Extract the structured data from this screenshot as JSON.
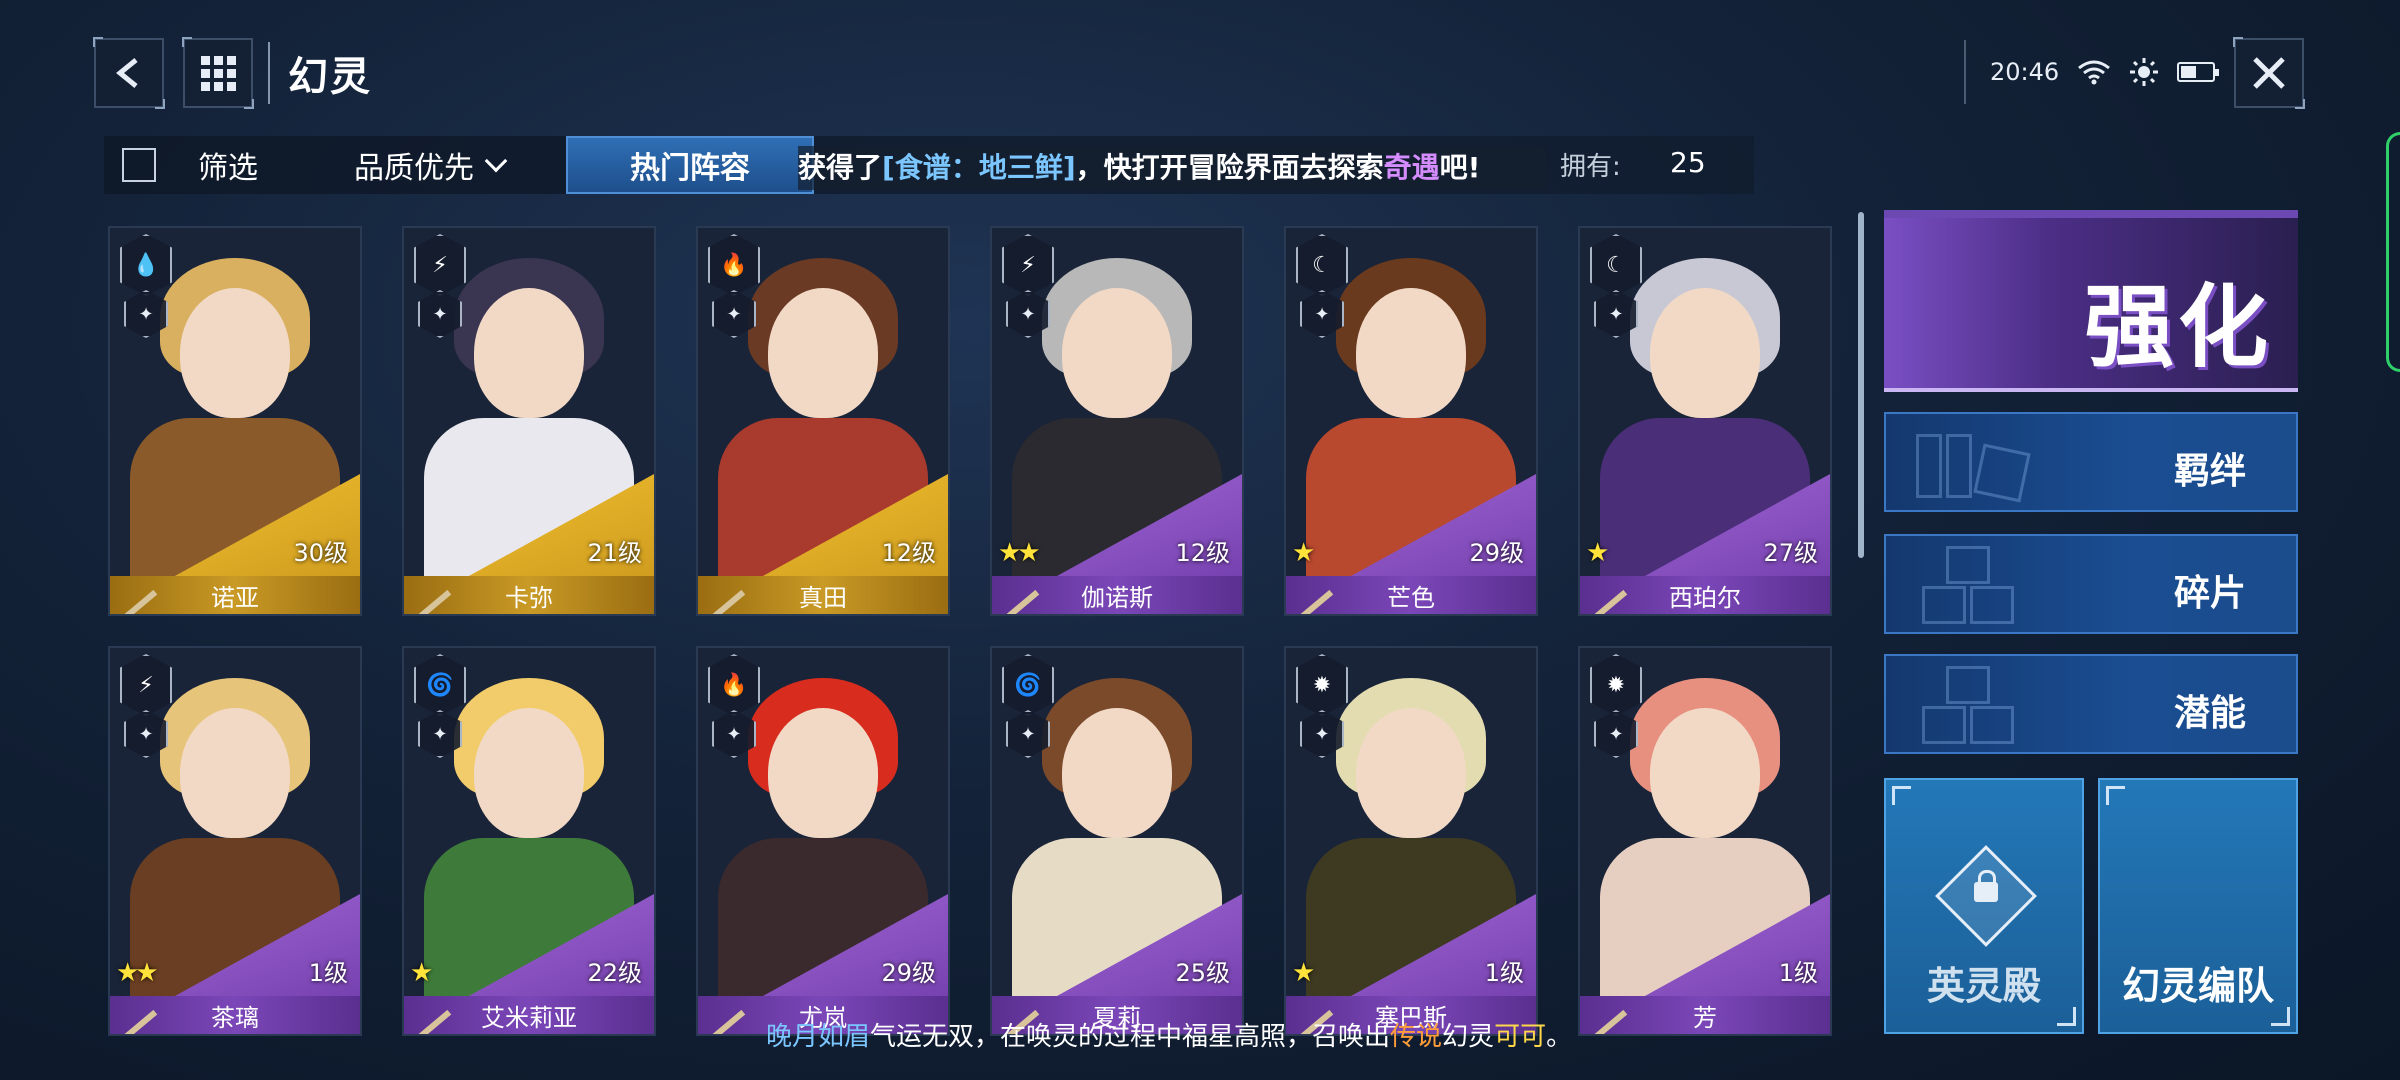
{
  "header": {
    "title": "幻灵",
    "time": "20:46"
  },
  "filter": {
    "label": "筛选",
    "sort_label": "品质优先",
    "hot_button": "热门阵容",
    "own_label": "拥有:",
    "own_count": "25"
  },
  "marquee": {
    "prefix": "获得了",
    "item": "[食谱：地三鲜]",
    "middle": "，快打开冒险界面去探索",
    "highlight": "奇遇",
    "suffix": "吧!"
  },
  "cards": [
    {
      "name": "诺亚",
      "level": "30级",
      "stars": "",
      "rarity": "gold",
      "element": "water",
      "element_icon": "💧",
      "color": "#8a5a2b",
      "hair": "#d8b060"
    },
    {
      "name": "卡弥",
      "level": "21级",
      "stars": "",
      "rarity": "gold",
      "element": "thunder",
      "element_icon": "⚡",
      "color": "#e8e8ee",
      "hair": "#3a3550"
    },
    {
      "name": "真田",
      "level": "12级",
      "stars": "",
      "rarity": "gold",
      "element": "fire",
      "element_icon": "🔥",
      "color": "#a83a2e",
      "hair": "#6a3a24"
    },
    {
      "name": "伽诺斯",
      "level": "12级",
      "stars": "★★",
      "rarity": "purple",
      "element": "thunder",
      "element_icon": "⚡",
      "color": "#2a2a30",
      "hair": "#b8b8b8"
    },
    {
      "name": "芒色",
      "level": "29级",
      "stars": "★",
      "rarity": "purple",
      "element": "moon",
      "element_icon": "☾",
      "color": "#b8482e",
      "hair": "#6a3a1e"
    },
    {
      "name": "西珀尔",
      "level": "27级",
      "stars": "★",
      "rarity": "purple",
      "element": "moon",
      "element_icon": "☾",
      "color": "#4a2e78",
      "hair": "#c8c8d4"
    },
    {
      "name": "茶璃",
      "level": "1级",
      "stars": "★★",
      "rarity": "purple",
      "element": "thunder",
      "element_icon": "⚡",
      "color": "#6a3e22",
      "hair": "#e6c47a"
    },
    {
      "name": "艾米莉亚",
      "level": "22级",
      "stars": "★",
      "rarity": "purple",
      "element": "wind",
      "element_icon": "🌀",
      "color": "#3e7a3a",
      "hair": "#f2cc6a"
    },
    {
      "name": "尤岚",
      "level": "29级",
      "stars": "",
      "rarity": "purple",
      "element": "fire",
      "element_icon": "🔥",
      "color": "#3a2a2e",
      "hair": "#d82c1e"
    },
    {
      "name": "夏莉",
      "level": "25级",
      "stars": "",
      "rarity": "purple",
      "element": "wind",
      "element_icon": "🌀",
      "color": "#e6dcc6",
      "hair": "#7a4a2a"
    },
    {
      "name": "塞巴斯",
      "level": "1级",
      "stars": "★",
      "rarity": "purple",
      "element": "light",
      "element_icon": "✹",
      "color": "#3e3a22",
      "hair": "#e2dcb0"
    },
    {
      "name": "芳",
      "level": "1级",
      "stars": "",
      "rarity": "purple",
      "element": "light",
      "element_icon": "✹",
      "color": "#e6cfc0",
      "hair": "#e89080"
    }
  ],
  "side_menu": {
    "enhance": "强化",
    "bond": "羁绊",
    "fragments": "碎片",
    "potential": "潜能",
    "hall": "英灵殿",
    "formation": "幻灵编队"
  },
  "ticker": {
    "name": "晚月如眉",
    "part1": "气运无双，在唤灵的过程中福星高照，召唤出",
    "rarity": "传说",
    "part2": "幻灵",
    "spirit": "可可",
    "end": "。"
  }
}
